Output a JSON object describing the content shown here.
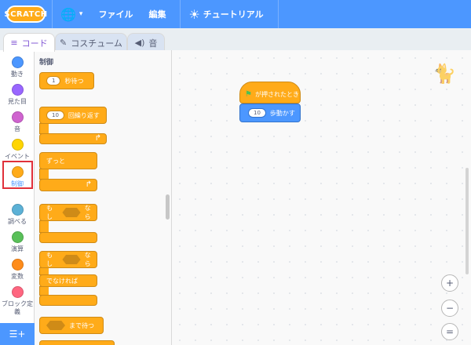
{
  "menubar": {
    "logo_text": "SCRATCH",
    "file_label": "ファイル",
    "edit_label": "編集",
    "tutorial_label": "チュートリアル",
    "icons": {
      "language": "globe-icon",
      "language_dropdown": "chevron-down-icon",
      "tutorial": "lightbulb-icon"
    }
  },
  "tabs": [
    {
      "label": "コード",
      "icon": "code-icon",
      "active": true
    },
    {
      "label": "コスチューム",
      "icon": "brush-icon",
      "active": false
    },
    {
      "label": "音",
      "icon": "speaker-icon",
      "active": false
    }
  ],
  "categories": [
    {
      "label": "動き",
      "color": "#4c97ff"
    },
    {
      "label": "見た目",
      "color": "#9966ff"
    },
    {
      "label": "音",
      "color": "#cf63cf"
    },
    {
      "label": "イベント",
      "color": "#ffd500"
    },
    {
      "label": "制御",
      "color": "#ffab19",
      "selected": true
    },
    {
      "label": "調べる",
      "color": "#5cb1d6"
    },
    {
      "label": "演算",
      "color": "#59c059"
    },
    {
      "label": "変数",
      "color": "#ff8c1a"
    },
    {
      "label": "ブロック定義",
      "color": "#ff6680"
    }
  ],
  "palette": {
    "title": "制御",
    "blocks": {
      "wait_value": "1",
      "wait_label": "秒待つ",
      "repeat_value": "10",
      "repeat_label": "回繰り返す",
      "forever_label": "ずっと",
      "if_label": "もし",
      "then_label": "なら",
      "if2_label": "もし",
      "then2_label": "なら",
      "else_label": "でなければ",
      "waituntil_label": "まで待つ"
    }
  },
  "script": {
    "hat_label": "が押されたとき",
    "move_value": "10",
    "move_label": "歩動かす"
  },
  "zoom": {
    "in": "+",
    "out": "−",
    "reset": "="
  },
  "colors": {
    "menubar": "#4c97ff",
    "control": "#ffab19",
    "motion": "#4c97ff",
    "highlight": "#e0303a"
  }
}
